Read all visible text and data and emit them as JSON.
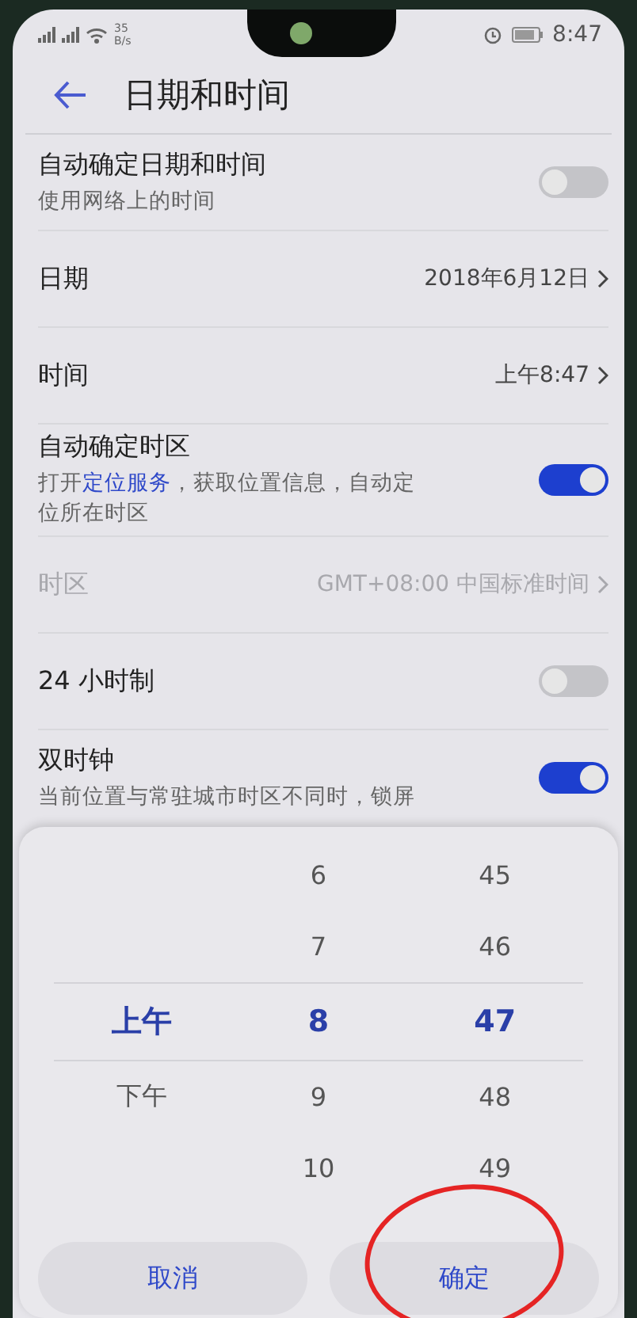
{
  "status_bar": {
    "network_speed": "35",
    "network_speed_unit": "B/s",
    "time": "8:47"
  },
  "header": {
    "title": "日期和时间"
  },
  "settings": [
    {
      "kind": "toggle",
      "label": "自动确定日期和时间",
      "description": "使用网络上的时间",
      "on": false
    },
    {
      "kind": "value",
      "label": "日期",
      "value": "2018年6月12日",
      "disabled": false
    },
    {
      "kind": "value",
      "label": "时间",
      "value": "上午8:47",
      "disabled": false
    },
    {
      "kind": "toggle",
      "label": "自动确定时区",
      "description_before": "打开",
      "link": "定位服务",
      "description_after": "，获取位置信息，自动定位所在时区",
      "on": true
    },
    {
      "kind": "value",
      "label": "时区",
      "value": "GMT+08:00 中国标准时间",
      "disabled": true
    },
    {
      "kind": "toggle",
      "label": "24 小时制",
      "on": false
    },
    {
      "kind": "toggle",
      "label": "双时钟",
      "description": "当前位置与常驻城市时区不同时，锁屏",
      "on": true
    }
  ],
  "time_picker": {
    "columns": [
      {
        "items": [
          {
            "label": "上午",
            "selected": true
          },
          {
            "label": "下午",
            "selected": false
          }
        ]
      },
      {
        "items": [
          {
            "label": "6",
            "selected": false
          },
          {
            "label": "7",
            "selected": false
          },
          {
            "label": "8",
            "selected": true
          },
          {
            "label": "9",
            "selected": false
          },
          {
            "label": "10",
            "selected": false
          }
        ]
      },
      {
        "items": [
          {
            "label": "45",
            "selected": false
          },
          {
            "label": "46",
            "selected": false
          },
          {
            "label": "47",
            "selected": true
          },
          {
            "label": "48",
            "selected": false
          },
          {
            "label": "49",
            "selected": false
          }
        ]
      }
    ],
    "buttons": [
      "取消",
      "确定"
    ]
  },
  "annotation": {
    "kind": "ellipse"
  }
}
